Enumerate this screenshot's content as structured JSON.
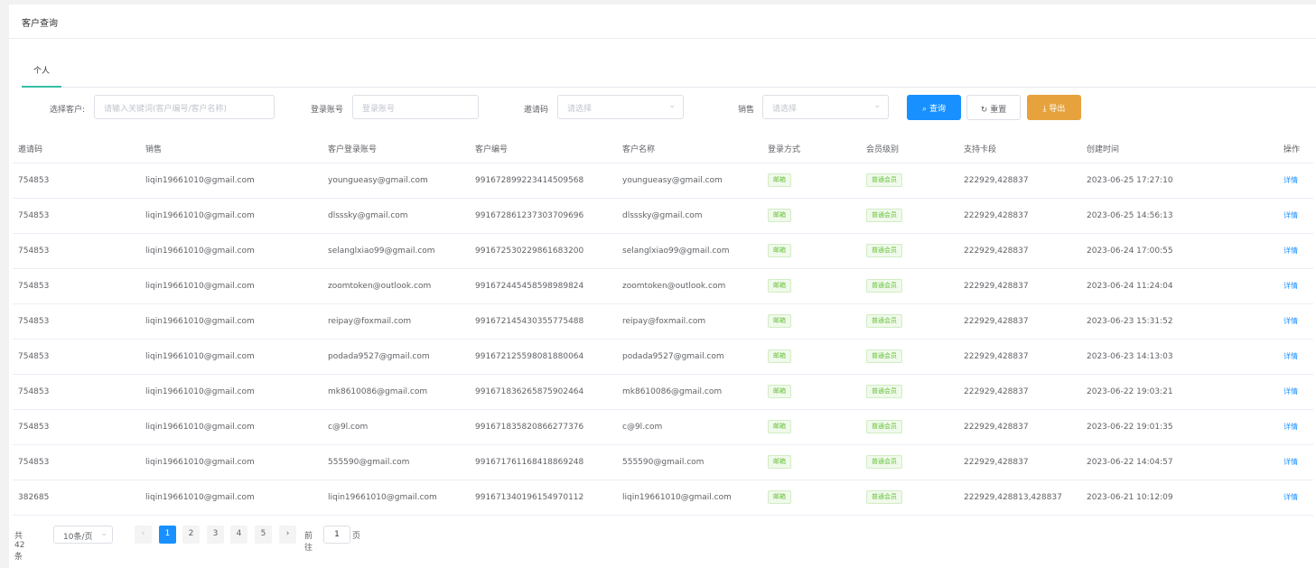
{
  "card": {
    "title": "客户查询"
  },
  "tabs": [
    {
      "label": "个人"
    }
  ],
  "filters": {
    "customer_label": "选择客户:",
    "customer_placeholder": "请输入关键词(客户编号/客户名称)",
    "account_label": "登录账号",
    "account_placeholder": "登录账号",
    "invite_label": "邀请码",
    "invite_placeholder": "请选择",
    "sales_label": "销售",
    "sales_placeholder": "请选择"
  },
  "buttons": {
    "search": "查询",
    "reset": "重置",
    "export": "导出"
  },
  "table": {
    "headers": [
      "邀请码",
      "销售",
      "客户登录账号",
      "客户编号",
      "客户名称",
      "登录方式",
      "会员级别",
      "支持卡段",
      "创建时间",
      "操作"
    ],
    "rows": [
      {
        "invite": "754853",
        "sales": "liqin19661010@gmail.com",
        "account": "youngueasy@gmail.com",
        "id": "991672899223414509568",
        "name": "youngueasy@gmail.com",
        "login": "邮箱",
        "level": "普通会员",
        "cards": "222929,428837",
        "created": "2023-06-25 17:27:10",
        "action": "详情"
      },
      {
        "invite": "754853",
        "sales": "liqin19661010@gmail.com",
        "account": "dlsssky@gmail.com",
        "id": "991672861237303709696",
        "name": "dlsssky@gmail.com",
        "login": "邮箱",
        "level": "普通会员",
        "cards": "222929,428837",
        "created": "2023-06-25 14:56:13",
        "action": "详情"
      },
      {
        "invite": "754853",
        "sales": "liqin19661010@gmail.com",
        "account": "selanglxiao99@gmail.com",
        "id": "991672530229861683200",
        "name": "selanglxiao99@gmail.com",
        "login": "邮箱",
        "level": "普通会员",
        "cards": "222929,428837",
        "created": "2023-06-24 17:00:55",
        "action": "详情"
      },
      {
        "invite": "754853",
        "sales": "liqin19661010@gmail.com",
        "account": "zoomtoken@outlook.com",
        "id": "991672445458598989824",
        "name": "zoomtoken@outlook.com",
        "login": "邮箱",
        "level": "普通会员",
        "cards": "222929,428837",
        "created": "2023-06-24 11:24:04",
        "action": "详情"
      },
      {
        "invite": "754853",
        "sales": "liqin19661010@gmail.com",
        "account": "reipay@foxmail.com",
        "id": "991672145430355775488",
        "name": "reipay@foxmail.com",
        "login": "邮箱",
        "level": "普通会员",
        "cards": "222929,428837",
        "created": "2023-06-23 15:31:52",
        "action": "详情"
      },
      {
        "invite": "754853",
        "sales": "liqin19661010@gmail.com",
        "account": "podada9527@gmail.com",
        "id": "991672125598081880064",
        "name": "podada9527@gmail.com",
        "login": "邮箱",
        "level": "普通会员",
        "cards": "222929,428837",
        "created": "2023-06-23 14:13:03",
        "action": "详情"
      },
      {
        "invite": "754853",
        "sales": "liqin19661010@gmail.com",
        "account": "mk8610086@gmail.com",
        "id": "991671836265875902464",
        "name": "mk8610086@gmail.com",
        "login": "邮箱",
        "level": "普通会员",
        "cards": "222929,428837",
        "created": "2023-06-22 19:03:21",
        "action": "详情"
      },
      {
        "invite": "754853",
        "sales": "liqin19661010@gmail.com",
        "account": "c@9l.com",
        "id": "991671835820866277376",
        "name": "c@9l.com",
        "login": "邮箱",
        "level": "普通会员",
        "cards": "222929,428837",
        "created": "2023-06-22 19:01:35",
        "action": "详情"
      },
      {
        "invite": "754853",
        "sales": "liqin19661010@gmail.com",
        "account": "555590@gmail.com",
        "id": "991671761168418869248",
        "name": "555590@gmail.com",
        "login": "邮箱",
        "level": "普通会员",
        "cards": "222929,428837",
        "created": "2023-06-22 14:04:57",
        "action": "详情"
      },
      {
        "invite": "382685",
        "sales": "liqin19661010@gmail.com",
        "account": "liqin19661010@gmail.com",
        "id": "991671340196154970112",
        "name": "liqin19661010@gmail.com",
        "login": "邮箱",
        "level": "普通会员",
        "cards": "222929,428813,428837",
        "created": "2023-06-21 10:12:09",
        "action": "详情"
      }
    ]
  },
  "pagination": {
    "total": "共 42 条",
    "page_size": "10条/页",
    "prev": "‹",
    "next": "›",
    "pages": [
      "1",
      "2",
      "3",
      "4",
      "5"
    ],
    "current": "1",
    "goto_label": "前往",
    "goto_value": "1",
    "page_unit": "页"
  }
}
